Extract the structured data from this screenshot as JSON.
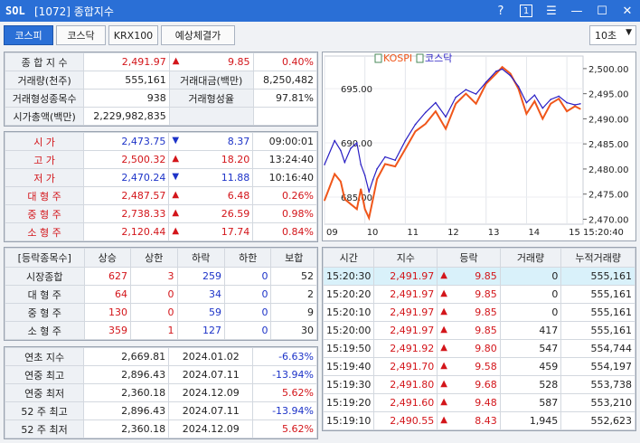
{
  "window": {
    "logo": "SOL",
    "title": "[1072] 종합지수",
    "help_icon": "?",
    "number_icon": "1",
    "menu_icon": "☰",
    "minimize_icon": "—",
    "maximize_icon": "☐",
    "close_icon": "✕"
  },
  "tabs": [
    "코스피",
    "코스닥",
    "KRX100",
    "예상체결가"
  ],
  "interval": "10초",
  "summary": {
    "index_label": "종 합 지 수",
    "index_value": "2,491.97",
    "index_arrow": "▲",
    "index_change": "9.85",
    "index_rate": "0.40%",
    "volume_label": "거래량(천주)",
    "volume_value": "555,161",
    "amount_label": "거래대금(백만)",
    "amount_value": "8,250,482",
    "count_label": "거래형성종목수",
    "count_value": "938",
    "ratio_label": "거래형성율",
    "ratio_value": "97.81%",
    "cap_label": "시가총액(백만)",
    "cap_value": "2,229,982,835"
  },
  "prices": [
    {
      "label": "시 가",
      "value": "2,473.75",
      "arrow": "▼",
      "change": "8.37",
      "extra": "09:00:01",
      "dir": "dn",
      "extra_color": "plain"
    },
    {
      "label": "고 가",
      "value": "2,500.32",
      "arrow": "▲",
      "change": "18.20",
      "extra": "13:24:40",
      "dir": "up",
      "extra_color": "plain"
    },
    {
      "label": "저 가",
      "value": "2,470.24",
      "arrow": "▼",
      "change": "11.88",
      "extra": "10:16:40",
      "dir": "dn",
      "extra_color": "plain"
    },
    {
      "label": "대 형 주",
      "value": "2,487.57",
      "arrow": "▲",
      "change": "6.48",
      "extra": "0.26%",
      "dir": "up",
      "extra_color": "red"
    },
    {
      "label": "중 형 주",
      "value": "2,738.33",
      "arrow": "▲",
      "change": "26.59",
      "extra": "0.98%",
      "dir": "up",
      "extra_color": "red"
    },
    {
      "label": "소 형 주",
      "value": "2,120.44",
      "arrow": "▲",
      "change": "17.74",
      "extra": "0.84%",
      "dir": "up",
      "extra_color": "red"
    }
  ],
  "breadth": {
    "headers": [
      "[등락종목수]",
      "상승",
      "상한",
      "하락",
      "하한",
      "보합"
    ],
    "rows": [
      {
        "label": "시장종합",
        "up": "627",
        "upper": "3",
        "down": "259",
        "lower": "0",
        "flat": "52"
      },
      {
        "label": "대 형 주",
        "up": "64",
        "upper": "0",
        "down": "34",
        "lower": "0",
        "flat": "2"
      },
      {
        "label": "중 형 주",
        "up": "130",
        "upper": "0",
        "down": "59",
        "lower": "0",
        "flat": "9"
      },
      {
        "label": "소 형 주",
        "up": "359",
        "upper": "1",
        "down": "127",
        "lower": "0",
        "flat": "30"
      }
    ]
  },
  "yearly": [
    {
      "label": "연초 지수",
      "value": "2,669.81",
      "date": "2024.01.02",
      "rate": "-6.63%",
      "dir": "dn"
    },
    {
      "label": "연중 최고",
      "value": "2,896.43",
      "date": "2024.07.11",
      "rate": "-13.94%",
      "dir": "dn"
    },
    {
      "label": "연중 최저",
      "value": "2,360.18",
      "date": "2024.12.09",
      "rate": "5.62%",
      "dir": "up"
    },
    {
      "label": "52 주 최고",
      "value": "2,896.43",
      "date": "2024.07.11",
      "rate": "-13.94%",
      "dir": "dn"
    },
    {
      "label": "52 주 최저",
      "value": "2,360.18",
      "date": "2024.12.09",
      "rate": "5.62%",
      "dir": "up"
    }
  ],
  "ticks": {
    "headers": [
      "시간",
      "지수",
      "등락",
      "거래량",
      "누적거래량"
    ],
    "rows": [
      {
        "time": "15:20:30",
        "index": "2,491.97",
        "arrow": "▲",
        "change": "9.85",
        "vol": "0",
        "cum": "555,161"
      },
      {
        "time": "15:20:20",
        "index": "2,491.97",
        "arrow": "▲",
        "change": "9.85",
        "vol": "0",
        "cum": "555,161"
      },
      {
        "time": "15:20:10",
        "index": "2,491.97",
        "arrow": "▲",
        "change": "9.85",
        "vol": "0",
        "cum": "555,161"
      },
      {
        "time": "15:20:00",
        "index": "2,491.97",
        "arrow": "▲",
        "change": "9.85",
        "vol": "417",
        "cum": "555,161"
      },
      {
        "time": "15:19:50",
        "index": "2,491.92",
        "arrow": "▲",
        "change": "9.80",
        "vol": "547",
        "cum": "554,744"
      },
      {
        "time": "15:19:40",
        "index": "2,491.70",
        "arrow": "▲",
        "change": "9.58",
        "vol": "459",
        "cum": "554,197"
      },
      {
        "time": "15:19:30",
        "index": "2,491.80",
        "arrow": "▲",
        "change": "9.68",
        "vol": "528",
        "cum": "553,738"
      },
      {
        "time": "15:19:20",
        "index": "2,491.60",
        "arrow": "▲",
        "change": "9.48",
        "vol": "587",
        "cum": "553,210"
      },
      {
        "time": "15:19:10",
        "index": "2,490.55",
        "arrow": "▲",
        "change": "8.43",
        "vol": "1,945",
        "cum": "552,623"
      }
    ]
  },
  "colors": {
    "accent": "#2a6fd6",
    "up": "#d3151a",
    "down": "#1d33c8",
    "kospi_line": "#f0561a",
    "kosdaq_line": "#2a1fc4"
  },
  "chart_data": {
    "type": "line",
    "x_ticks": [
      "09",
      "10",
      "11",
      "12",
      "13",
      "14",
      "15"
    ],
    "last_time_label": "15:20:40",
    "left_axis_ticks": [
      "695.00",
      "690.00",
      "685.00"
    ],
    "left_ylim": [
      682.5,
      698.0
    ],
    "right_axis_ticks": [
      "2,500.00",
      "2,495.00",
      "2,490.00",
      "2,485.00",
      "2,480.00",
      "2,475.00",
      "2,470.00"
    ],
    "right_ylim": [
      2469.0,
      2502.5
    ],
    "series": [
      {
        "name": "KOSPI",
        "axis": "right",
        "x": [
          9.0,
          9.25,
          9.4,
          9.5,
          9.65,
          9.8,
          9.9,
          10.0,
          10.1,
          10.2,
          10.3,
          10.5,
          10.75,
          11.0,
          11.25,
          11.5,
          11.75,
          12.0,
          12.25,
          12.5,
          12.75,
          13.0,
          13.25,
          13.4,
          13.6,
          13.8,
          14.0,
          14.2,
          14.4,
          14.6,
          14.8,
          15.0,
          15.2,
          15.33
        ],
        "values": [
          2473.75,
          2479.0,
          2477.5,
          2474.0,
          2473.0,
          2472.0,
          2476.0,
          2472.0,
          2470.24,
          2474.0,
          2478.0,
          2481.0,
          2480.5,
          2484.0,
          2487.5,
          2489.0,
          2491.5,
          2488.0,
          2493.0,
          2495.0,
          2493.0,
          2497.0,
          2499.0,
          2500.32,
          2499.0,
          2496.0,
          2491.0,
          2493.5,
          2490.0,
          2493.0,
          2494.0,
          2491.5,
          2492.5,
          2491.97
        ]
      },
      {
        "name": "코스닥",
        "axis": "left",
        "x": [
          9.0,
          9.25,
          9.4,
          9.5,
          9.65,
          9.8,
          9.9,
          10.0,
          10.1,
          10.2,
          10.3,
          10.5,
          10.75,
          11.0,
          11.25,
          11.5,
          11.75,
          12.0,
          12.25,
          12.5,
          12.75,
          13.0,
          13.25,
          13.4,
          13.6,
          13.8,
          14.0,
          14.2,
          14.4,
          14.6,
          14.8,
          15.0,
          15.2,
          15.33
        ],
        "values": [
          688.0,
          690.2,
          689.3,
          688.2,
          689.5,
          690.0,
          688.0,
          687.0,
          685.5,
          686.6,
          687.6,
          688.7,
          688.4,
          690.2,
          691.7,
          692.8,
          693.7,
          692.4,
          694.2,
          694.9,
          694.5,
          695.6,
          696.6,
          696.8,
          696.2,
          695.2,
          693.7,
          694.4,
          693.2,
          694.0,
          694.3,
          693.7,
          693.5,
          693.6
        ]
      }
    ]
  }
}
